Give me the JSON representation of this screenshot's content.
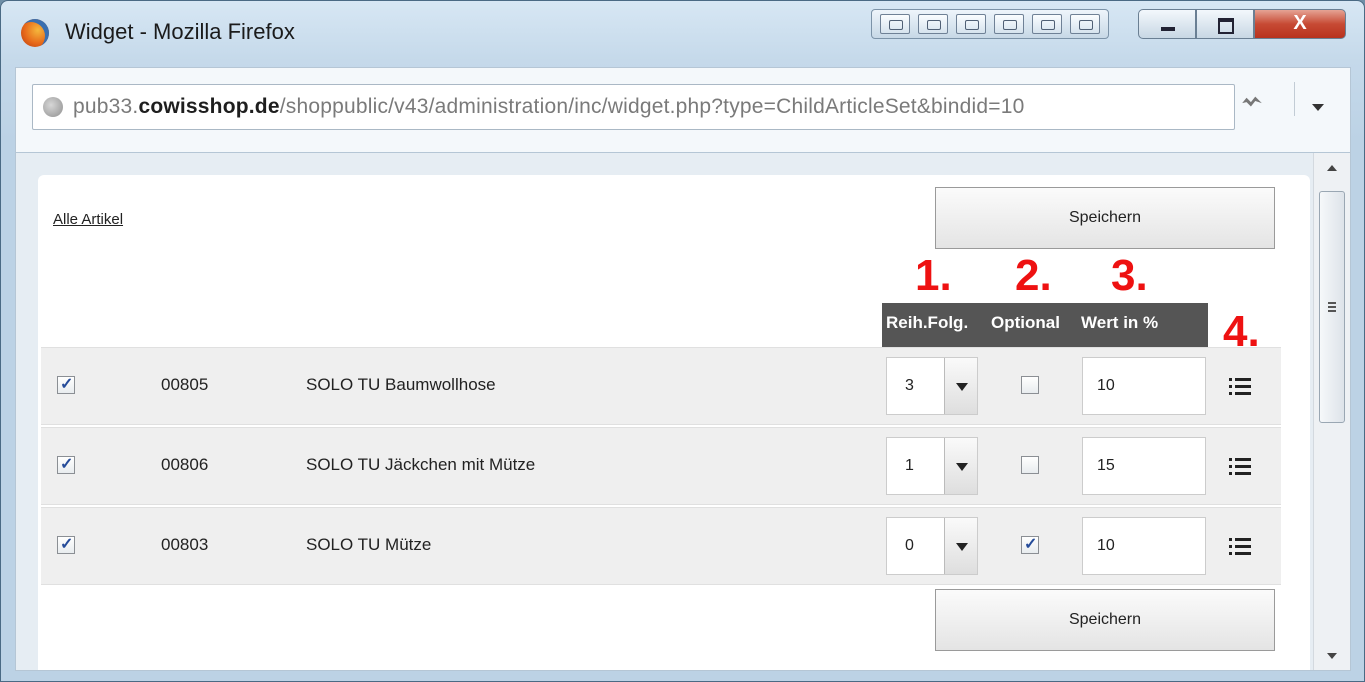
{
  "window": {
    "title": "Widget - Mozilla Firefox",
    "close_label": "X"
  },
  "urlbar": {
    "prefix": "pub33.",
    "host": "cowisshop.de",
    "path": "/shoppublic/v43/administration/inc/widget.php?type=ChildArticleSet&bindid=10"
  },
  "page": {
    "all_link": "Alle Artikel",
    "save_label": "Speichern",
    "annotations": [
      "1.",
      "2.",
      "3.",
      "4."
    ],
    "headers": {
      "order": "Reih.Folg.",
      "optional": "Optional",
      "value": "Wert in %"
    },
    "rows": [
      {
        "selected": true,
        "nr": "00805",
        "name": "SOLO TU Baumwollhose",
        "order": "3",
        "optional": false,
        "value": "10"
      },
      {
        "selected": true,
        "nr": "00806",
        "name": "SOLO TU Jäckchen mit Mütze",
        "order": "1",
        "optional": false,
        "value": "15"
      },
      {
        "selected": true,
        "nr": "00803",
        "name": "SOLO TU Mütze",
        "order": "0",
        "optional": true,
        "value": "10"
      }
    ]
  },
  "icons": {
    "browser": "firefox-icon",
    "security": "globe-icon",
    "row_action": "list-icon"
  },
  "colors": {
    "annotation": "#e11111",
    "header_bg": "#555555"
  }
}
